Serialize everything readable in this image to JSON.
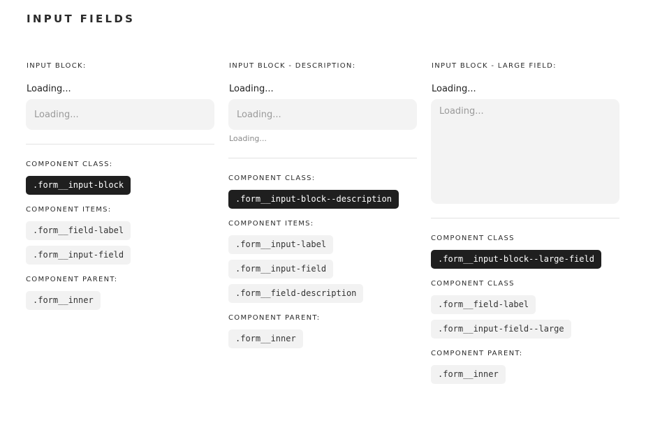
{
  "page": {
    "title": "INPUT FIELDS"
  },
  "columns": [
    {
      "heading": "INPUT BLOCK:",
      "field_label": "Loading...",
      "placeholder": "Loading...",
      "component_class_heading": "COMPONENT CLASS:",
      "component_class": ".form__input-block",
      "component_items_heading": "COMPONENT ITEMS:",
      "component_items": [
        ".form__field-label",
        ".form__input-field"
      ],
      "component_parent_heading": "COMPONENT PARENT:",
      "component_parent": ".form__inner"
    },
    {
      "heading": "INPUT BLOCK - DESCRIPTION:",
      "field_label": "Loading...",
      "placeholder": "Loading...",
      "description": "Loading...",
      "component_class_heading": "COMPONENT CLASS:",
      "component_class": ".form__input-block--description",
      "component_items_heading": "COMPONENT ITEMS:",
      "component_items": [
        ".form__input-label",
        ".form__input-field",
        ".form__field-description"
      ],
      "component_parent_heading": "COMPONENT PARENT:",
      "component_parent": ".form__inner"
    },
    {
      "heading": "INPUT BLOCK - LARGE FIELD:",
      "field_label": "Loading...",
      "placeholder": "Loading...",
      "component_class_heading": "COMPONENT CLASS",
      "component_class": ".form__input-block--large-field",
      "component_items_heading": "COMPONENT CLASS",
      "component_items": [
        ".form__field-label",
        ".form__input-field--large"
      ],
      "component_parent_heading": "COMPONENT PARENT:",
      "component_parent": ".form__inner"
    }
  ]
}
